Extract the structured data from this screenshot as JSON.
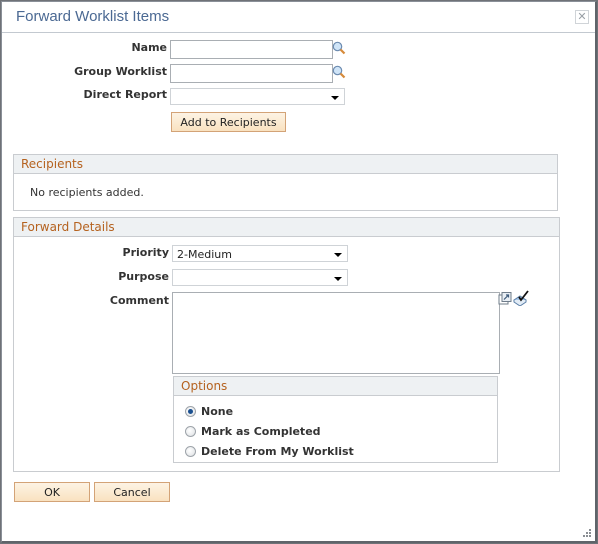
{
  "dialog": {
    "title": "Forward Worklist Items",
    "close_icon": "close-icon"
  },
  "search": {
    "name_label": "Name",
    "name_value": "",
    "group_worklist_label": "Group Worklist",
    "group_worklist_value": "",
    "direct_report_label": "Direct Report",
    "direct_report_value": "",
    "add_button": "Add to Recipients",
    "lookup_icon": "magnifier-icon"
  },
  "recipients": {
    "header": "Recipients",
    "empty_text": "No recipients added."
  },
  "forward_details": {
    "header": "Forward Details",
    "priority_label": "Priority",
    "priority_value": "2-Medium",
    "purpose_label": "Purpose",
    "purpose_value": "",
    "comment_label": "Comment",
    "comment_value": "",
    "expand_icon": "expand-icon",
    "spellcheck_icon": "spellcheck-icon",
    "options": {
      "header": "Options",
      "items": [
        {
          "label": "None",
          "selected": true
        },
        {
          "label": "Mark as Completed",
          "selected": false
        },
        {
          "label": "Delete From My Worklist",
          "selected": false
        }
      ]
    }
  },
  "footer": {
    "ok": "OK",
    "cancel": "Cancel"
  }
}
